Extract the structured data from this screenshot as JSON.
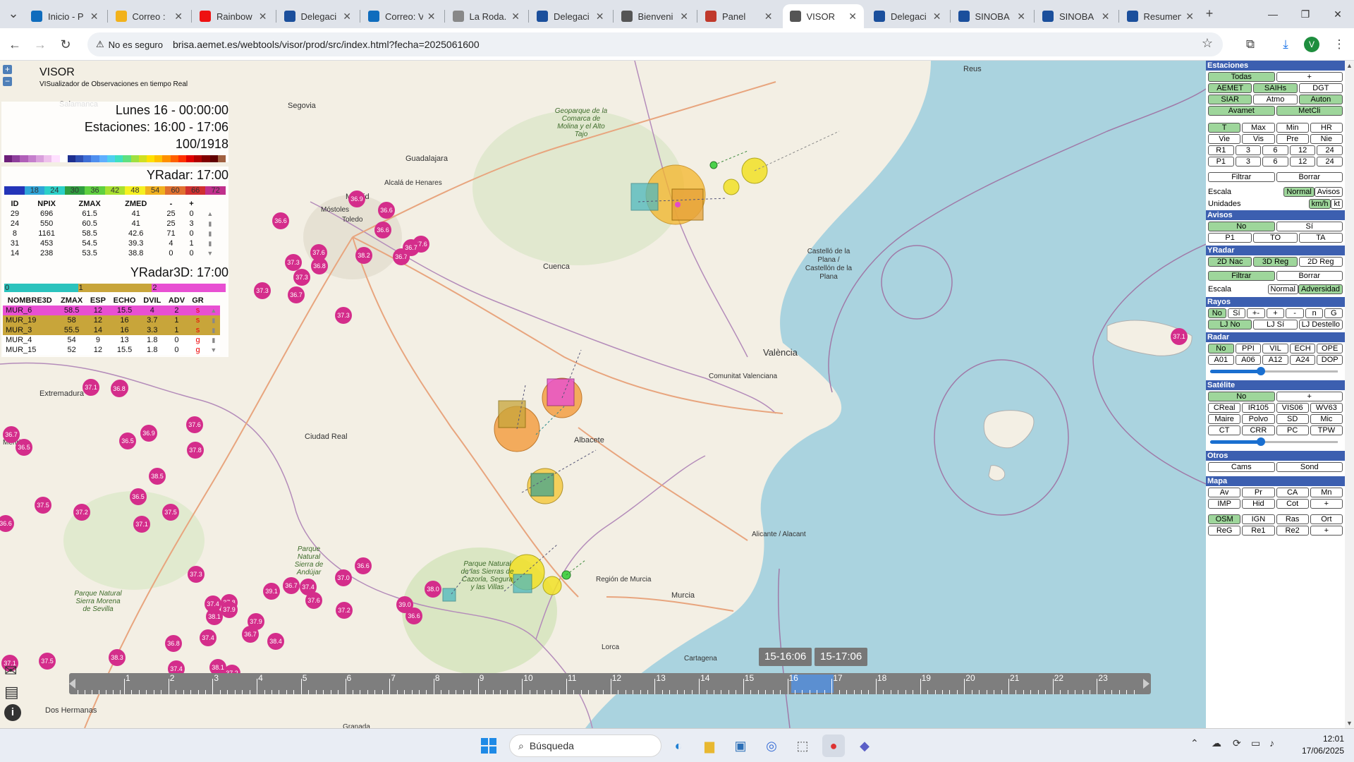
{
  "browser": {
    "tabs": [
      {
        "label": "Inicio - P",
        "color": "#0f6cbd"
      },
      {
        "label": "Correo :",
        "color": "#f2b21b"
      },
      {
        "label": "Rainbow",
        "color": "#e11"
      },
      {
        "label": "Delegaci",
        "color": "#1b4f9c"
      },
      {
        "label": "Correo: V",
        "color": "#0f6cbd"
      },
      {
        "label": "La Roda.",
        "color": "#888"
      },
      {
        "label": "Delegaci",
        "color": "#1b4f9c"
      },
      {
        "label": "Bienveni",
        "color": "#555"
      },
      {
        "label": "Panel",
        "color": "#c0392b"
      },
      {
        "label": "VISOR",
        "color": "#555"
      },
      {
        "label": "Delegaci",
        "color": "#1b4f9c"
      },
      {
        "label": "SINOBA",
        "color": "#1b4f9c"
      },
      {
        "label": "SINOBA",
        "color": "#1b4f9c"
      },
      {
        "label": "Resumen",
        "color": "#1b4f9c"
      }
    ],
    "new_tab": "+",
    "security": "No es seguro",
    "url": "brisa.aemet.es/webtools/visor/prod/src/index.html?fecha=2025061600",
    "avatar": "V"
  },
  "visor": {
    "zoom_in": "+",
    "zoom_out": "−",
    "title": "VISOR",
    "subtitle": "VISualizador de Observaciones en tiempo Real",
    "date_line": "Lunes 16 - 00:00:00",
    "stations_line": "Estaciones: 16:00 - 17:06",
    "count_line": "100/1918",
    "yradar_title": "YRadar: 17:00",
    "yradar_scale": [
      "18",
      "24",
      "30",
      "36",
      "42",
      "48",
      "54",
      "60",
      "66",
      "72"
    ],
    "yradar_headers": [
      "ID",
      "NPIX",
      "ZMAX",
      "ZMED",
      "-",
      "+"
    ],
    "yradar_rows": [
      [
        "29",
        "696",
        "61.5",
        "41",
        "25",
        "0"
      ],
      [
        "24",
        "550",
        "60.5",
        "41",
        "25",
        "3"
      ],
      [
        "8",
        "1161",
        "58.5",
        "42.6",
        "71",
        "0"
      ],
      [
        "31",
        "453",
        "54.5",
        "39.3",
        "4",
        "1"
      ],
      [
        "14",
        "238",
        "53.5",
        "38.8",
        "0",
        "0"
      ]
    ],
    "yradar3d_title": "YRadar3D: 17:00",
    "yradar3d_scale": [
      "0",
      "1",
      "2"
    ],
    "yradar3d_headers": [
      "NOMBRE3D",
      "ZMAX",
      "ESP",
      "ECHO",
      "DVIL",
      "ADV",
      "GR"
    ],
    "yradar3d_rows": [
      [
        "MUR_6",
        "58.5",
        "12",
        "15.5",
        "4",
        "2",
        "s"
      ],
      [
        "MUR_19",
        "58",
        "12",
        "16",
        "3.7",
        "1",
        "s"
      ],
      [
        "MUR_3",
        "55.5",
        "14",
        "16",
        "3.3",
        "1",
        "s"
      ],
      [
        "MUR_4",
        "54",
        "9",
        "13",
        "1.8",
        "0",
        "g"
      ],
      [
        "MUR_15",
        "52",
        "12",
        "15.5",
        "1.8",
        "0",
        "g"
      ]
    ],
    "row_colors": [
      "#e84fd2",
      "#c8a53a",
      "#c8a53a",
      "#ffffff",
      "#ffffff"
    ]
  },
  "map_labels": {
    "cities": [
      "Salamanca",
      "Segovia",
      "Guadalajara",
      "Alcalá de Henares",
      "Madrid",
      "Móstoles",
      "Toledo",
      "Cuenca",
      "Ciudad Real",
      "Albacete",
      "València",
      "Castelló de la Plana / Castellón de la Plana",
      "Alicante / Alacant",
      "Murcia",
      "Lorca",
      "Cartagena",
      "Mérida",
      "Extremadura",
      "Reus",
      "Comunitat Valenciana",
      "Región de Murcia",
      "Dos Hermanas",
      "Granada"
    ],
    "parks": [
      "Geoparque de la Comarca de Molina y el Alto Tajo",
      "Parque Natural Sierra de Andújar",
      "Parque Natural Sierra Morena de Sevilla",
      "Parque Natural de las Sierras de Cazorla, Segura y las Villas"
    ]
  },
  "temps": [
    "36.9",
    "36.6",
    "36.6",
    "36.6",
    "37.6",
    "38.2",
    "36.7",
    "37.6",
    "36.7",
    "37.3",
    "36.8",
    "37.3",
    "37.3",
    "36.7",
    "37.3",
    "37.1",
    "37.1",
    "36.8",
    "36.9",
    "37.6",
    "36.5",
    "37.8",
    "36.7",
    "36.5",
    "38.5",
    "36.5",
    "37.5",
    "37.2",
    "37.1",
    "37.5",
    "36.6",
    "37.3",
    "37.0",
    "36.6",
    "39.1",
    "36.7",
    "37.4",
    "37.6",
    "37.2",
    "39.0",
    "38.0",
    "36.6",
    "37.8",
    "37.4",
    "37.9",
    "38.1",
    "37.9",
    "36.7",
    "37.4",
    "38.4",
    "36.8",
    "38.3",
    "38.1",
    "37.2",
    "37.4",
    "36.8",
    "37.5",
    "37.1",
    "37.1"
  ],
  "timeline": {
    "ticks": [
      "1",
      "2",
      "3",
      "4",
      "5",
      "6",
      "7",
      "8",
      "9",
      "10",
      "11",
      "12",
      "13",
      "14",
      "15",
      "16",
      "17",
      "18",
      "19",
      "20",
      "21",
      "22",
      "23"
    ],
    "start_label": "15-16:06",
    "end_label": "15-17:06"
  },
  "right_panel": {
    "estaciones": "Estaciones",
    "st_row1": [
      "Todas",
      "+"
    ],
    "st_row2": [
      "AEMET",
      "SAIHs",
      "DGT"
    ],
    "st_row3": [
      "SIAR",
      "Atmo",
      "Auton"
    ],
    "st_row4": [
      "Avamet",
      "MetCli"
    ],
    "var_row1": [
      "T",
      "Max",
      "Min",
      "HR"
    ],
    "var_row2": [
      "Vie",
      "Vis",
      "Pre",
      "Nie"
    ],
    "var_row3": [
      "R1",
      "3",
      "6",
      "12",
      "24"
    ],
    "var_row4": [
      "P1",
      "3",
      "6",
      "12",
      "24"
    ],
    "filter_row": [
      "Filtrar",
      "Borrar"
    ],
    "escala_label": "Escala",
    "escala_opts": [
      "Normal",
      "Avisos"
    ],
    "unidades_label": "Unidades",
    "unidades_opts": [
      "km/h",
      "kt"
    ],
    "avisos": "Avisos",
    "av_row1": [
      "No",
      "Sí"
    ],
    "av_row2": [
      "P1",
      "TO",
      "TA"
    ],
    "yradar": "YRadar",
    "yr_row1": [
      "2D Nac",
      "3D Reg",
      "2D Reg"
    ],
    "yr_row2": [
      "Filtrar",
      "Borrar"
    ],
    "yr_escala_label": "Escala",
    "yr_escala_opts": [
      "Normal",
      "Adversidad"
    ],
    "rayos": "Rayos",
    "ry_row1": [
      "No",
      "Sí",
      "+-",
      "+",
      "-",
      "n",
      "G"
    ],
    "ry_row2": [
      "LJ No",
      "LJ Sí",
      "LJ Destello"
    ],
    "radar": "Radar",
    "rd_row1": [
      "No",
      "PPI",
      "VIL",
      "ECH",
      "OPE"
    ],
    "rd_row2": [
      "A01",
      "A06",
      "A12",
      "A24",
      "DOP"
    ],
    "radar_slider": 0.4,
    "satelite": "Satélite",
    "sat_row1": [
      "No",
      "+"
    ],
    "sat_row2": [
      "CReal",
      "IR105",
      "VIS06",
      "WV63"
    ],
    "sat_row3": [
      "Maire",
      "Polvo",
      "SD",
      "Mic"
    ],
    "sat_row4": [
      "CT",
      "CRR",
      "PC",
      "TPW"
    ],
    "sat_slider": 0.4,
    "otros": "Otros",
    "ot_row1": [
      "Cams",
      "Sond"
    ],
    "mapa": "Mapa",
    "mp_row1": [
      "Av",
      "Pr",
      "CA",
      "Mn"
    ],
    "mp_row2": [
      "IMP",
      "Hid",
      "Cot",
      "+"
    ],
    "mp_row3": [
      "OSM",
      "IGN",
      "Ras",
      "Ort"
    ],
    "mp_row4": [
      "ReG",
      "Re1",
      "Re2",
      "+"
    ]
  },
  "taskbar": {
    "search": "Búsqueda",
    "time": "12:01",
    "date": "17/06/2025"
  }
}
